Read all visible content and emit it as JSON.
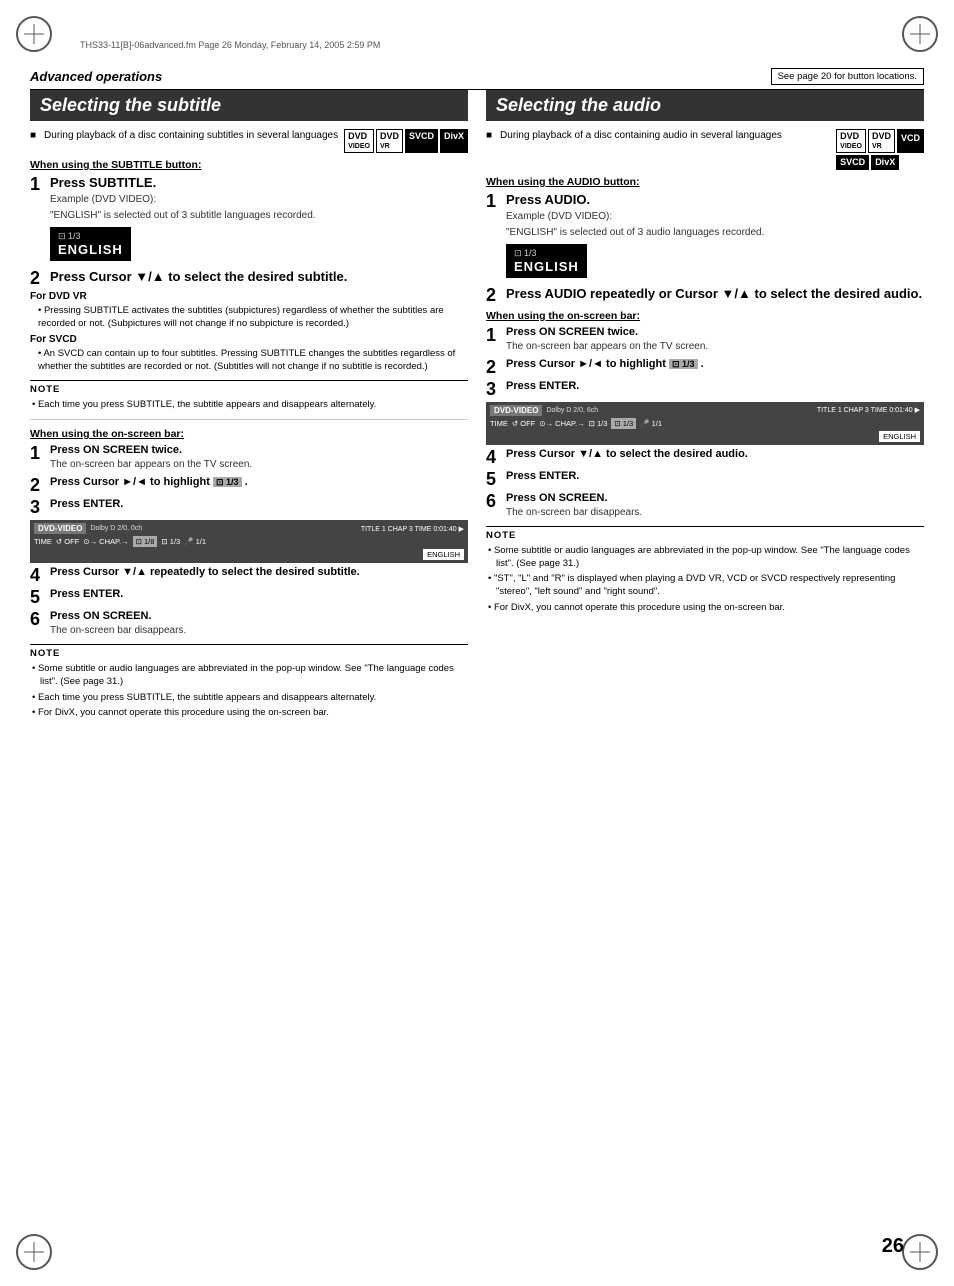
{
  "page": {
    "number": "26",
    "file_info": "THS33-11[B]-06advanced.fm  Page 26  Monday, February 14, 2005  2:59 PM"
  },
  "header": {
    "title": "Advanced operations",
    "note": "See page 20 for button locations."
  },
  "left": {
    "section_title": "Selecting the subtitle",
    "intro_bullet": "■",
    "intro_text": "During playback of a disc containing subtitles in several languages",
    "badges_top": [
      {
        "label": "DVD",
        "sub": "VIDEO",
        "style": "white"
      },
      {
        "label": "DVD",
        "sub": "VR",
        "style": "white"
      },
      {
        "label": "SVCD",
        "style": "black"
      },
      {
        "label": "DivX",
        "style": "black"
      }
    ],
    "subtitle_button_heading": "When using the SUBTITLE button:",
    "step1": {
      "num": "1",
      "title": "Press SUBTITLE.",
      "example_label": "Example (DVD VIDEO):",
      "example_text": "\"ENGLISH\" is selected out of 3 subtitle languages recorded."
    },
    "osd_line1": "1/3",
    "osd_line2": "ENGLISH",
    "step2": {
      "num": "2",
      "title": "Press Cursor ▼/▲ to select the desired subtitle."
    },
    "dvd_vr_label": "For DVD VR",
    "dvd_vr_note": "• Pressing SUBTITLE activates the subtitles (subpictures) regardless of whether the subtitles are recorded or not. (Subpictures will not change if no subpicture is recorded.)",
    "svcd_label": "For SVCD",
    "svcd_note": "• An SVCD can contain up to four subtitles. Pressing SUBTITLE changes the subtitles regardless of whether the subtitles are recorded or not. (Subtitles will not change if no subtitle is recorded.)",
    "note_title": "NOTE",
    "note_items": [
      "• Each time you press SUBTITLE, the subtitle appears and disappears alternately."
    ],
    "onscreen_heading": "When using the on-screen bar:",
    "onscreen_step1": {
      "num": "1",
      "title": "Press ON SCREEN twice.",
      "sub": "The on-screen bar appears on the TV screen."
    },
    "onscreen_step2": {
      "num": "2",
      "title": "Press Cursor ►/◄ to highlight",
      "highlight_symbol": "⊡ 1/3",
      "period": "."
    },
    "onscreen_step3": {
      "num": "3",
      "title": "Press ENTER."
    },
    "onscreen_step4": {
      "num": "4",
      "title": "Press Cursor ▼/▲ repeatedly to select the desired subtitle."
    },
    "onscreen_step5": {
      "num": "5",
      "title": "Press ENTER."
    },
    "onscreen_step6": {
      "num": "6",
      "title": "Press ON SCREEN.",
      "sub": "The on-screen bar disappears."
    },
    "bottom_note_title": "NOTE",
    "bottom_notes": [
      "• Some subtitle or audio languages are abbreviated in the pop-up window. See \"The language codes list\". (See page 31.)",
      "• Each time you press SUBTITLE, the subtitle appears and disappears alternately.",
      "• For DivX, you cannot operate this procedure using the on-screen bar."
    ]
  },
  "right": {
    "section_title": "Selecting the audio",
    "intro_bullet": "■",
    "intro_text": "During playback of a disc containing audio in several languages",
    "badges_top_row1": [
      {
        "label": "DVD",
        "sub": "VIDEO",
        "style": "white"
      },
      {
        "label": "DVD",
        "sub": "VR",
        "style": "white"
      },
      {
        "label": "VCD",
        "style": "black"
      }
    ],
    "badges_top_row2": [
      {
        "label": "SVCD",
        "style": "black"
      },
      {
        "label": "DivX",
        "style": "black"
      }
    ],
    "audio_button_heading": "When using the AUDIO button:",
    "step1": {
      "num": "1",
      "title": "Press AUDIO.",
      "example_label": "Example (DVD VIDEO):",
      "example_text": "\"ENGLISH\" is selected out of 3 audio languages recorded."
    },
    "osd_line1": "1/3",
    "osd_line2": "ENGLISH",
    "step2": {
      "num": "2",
      "title": "Press AUDIO repeatedly or Cursor ▼/▲ to select the desired audio."
    },
    "onscreen_heading": "When using the on-screen bar:",
    "onscreen_step1": {
      "num": "1",
      "title": "Press ON SCREEN twice.",
      "sub": "The on-screen bar appears on the TV screen."
    },
    "onscreen_step2": {
      "num": "2",
      "title": "Press Cursor ►/◄ to highlight",
      "highlight_symbol": "⊡ 1/3",
      "period": "."
    },
    "onscreen_step3": {
      "num": "3",
      "title": "Press ENTER."
    },
    "onscreen_step4": {
      "num": "4",
      "title": "Press Cursor ▼/▲ to select the desired audio."
    },
    "onscreen_step5": {
      "num": "5",
      "title": "Press ENTER."
    },
    "onscreen_step6": {
      "num": "6",
      "title": "Press ON SCREEN.",
      "sub": "The on-screen bar disappears."
    },
    "note_title": "NOTE",
    "note_items": [
      "• Some subtitle or audio languages are abbreviated in the pop-up window. See \"The language codes list\". (See page 31.)",
      "• \"ST\", \"L\" and \"R\" is displayed when playing a DVD VR, VCD or SVCD respectively representing \"stereo\", \"left sound\" and \"right sound\".",
      "• For DivX, you cannot operate this procedure using the on-screen bar."
    ]
  }
}
